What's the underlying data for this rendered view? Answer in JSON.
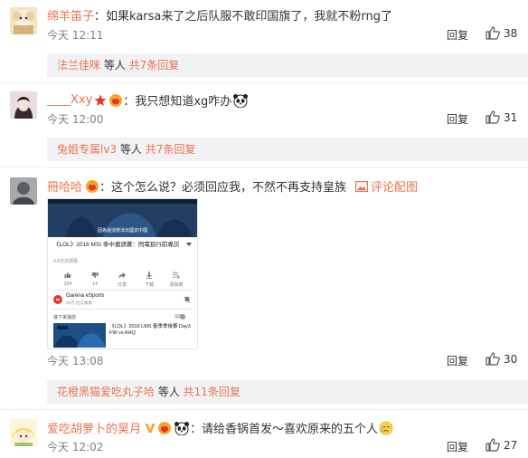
{
  "comments": [
    {
      "username": "绵羊笛子",
      "separator": "：",
      "text": "如果karsa来了之后队服不敢印国旗了，我就不粉rng了",
      "time": "今天 12:11",
      "reply_label": "回复",
      "likes": "38"
    },
    {
      "username": "____Xxy",
      "separator": "：",
      "text": "我只想知道xg咋办",
      "time": "今天 12:00",
      "reply_label": "回复",
      "likes": "31"
    },
    {
      "username": "冊哈哈",
      "separator": "：",
      "text": "这个怎么说？必须回应我，不然不再支持皇族",
      "link_text": "评论配图",
      "time": "今天 13:08",
      "reply_label": "回复",
      "likes": "30",
      "image": {
        "subtitle": "因為還沒辦法出國去中國",
        "video_title": "《LOL》2016 MSI 季中邀請賽：閃電狼行前專訪",
        "views": "9.4万次观看",
        "actions": [
          {
            "icon": "thumb-up",
            "count": "324"
          },
          {
            "icon": "thumb-down",
            "count": "14"
          },
          {
            "icon": "share",
            "label": "分享"
          },
          {
            "icon": "download",
            "label": "下载"
          },
          {
            "icon": "add",
            "label": "添加到"
          }
        ],
        "channel": "Garena eSports",
        "subscribers": "34万 位订阅者",
        "up_next": "接下来播放",
        "next_title": "《LOL》2016 LMS 春季季後賽 Day3 FW vs AHQ"
      }
    },
    {
      "username": "爱吃胡萝卜的昊月",
      "separator": "：",
      "text": "请给香锅首发～喜欢原来的五个人",
      "time": "今天 12:02",
      "reply_label": "回复",
      "likes": "27"
    }
  ],
  "replies": [
    {
      "user": "法兰佳咪",
      "suffix": " 等人 ",
      "count_text": "共7条回复"
    },
    {
      "user": "兔姐专属lv3",
      "suffix": " 等人 ",
      "count_text": "共7条回复"
    },
    {
      "user": "花橙黑猫爱吃丸子哈",
      "suffix": " 等人 ",
      "count_text": "共11条回复"
    }
  ],
  "colors": {
    "link": "#eb7350",
    "reply_bg": "#f2f2f5",
    "time": "#808080"
  }
}
